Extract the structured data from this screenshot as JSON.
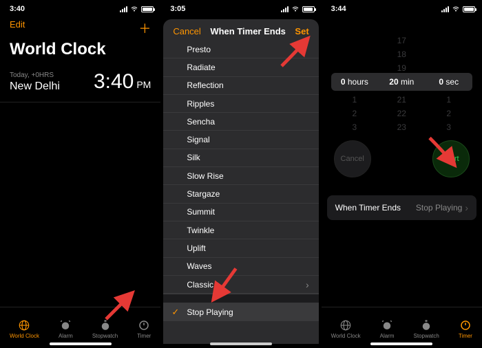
{
  "accent": "#ff9500",
  "phone1": {
    "status_time": "3:40",
    "edit": "Edit",
    "title": "World Clock",
    "clock": {
      "meta": "Today, +0HRS",
      "city": "New Delhi",
      "time": "3:40",
      "ampm": "PM"
    },
    "tabs": {
      "worldclock": "World Clock",
      "alarm": "Alarm",
      "stopwatch": "Stopwatch",
      "timer": "Timer",
      "active": "worldclock"
    }
  },
  "phone2": {
    "status_time": "3:05",
    "header": {
      "cancel": "Cancel",
      "title": "When Timer Ends",
      "set": "Set"
    },
    "sounds": [
      "Presto",
      "Radiate",
      "Reflection",
      "Ripples",
      "Sencha",
      "Signal",
      "Silk",
      "Slow Rise",
      "Stargaze",
      "Summit",
      "Twinkle",
      "Uplift",
      "Waves",
      "Classic"
    ],
    "stop_playing": "Stop Playing"
  },
  "phone3": {
    "status_time": "3:44",
    "picker": {
      "hours_value": "0",
      "hours_unit": "hours",
      "min_value": "20",
      "min_unit": "min",
      "sec_value": "0",
      "sec_unit": "sec",
      "fade_top_h": [
        "17",
        "18",
        "19"
      ],
      "fade_bot_h": [
        "21",
        "22",
        "23"
      ],
      "fade_top_m": [
        "",
        "",
        ""
      ],
      "fade_bot_m": [
        "1",
        "2",
        "3"
      ],
      "fade_top_s": [
        "",
        "",
        ""
      ],
      "fade_bot_s": [
        "1",
        "2",
        "3"
      ]
    },
    "cancel": "Cancel",
    "start": "Start",
    "ends": {
      "label": "When Timer Ends",
      "value": "Stop Playing"
    },
    "tabs": {
      "worldclock": "World Clock",
      "alarm": "Alarm",
      "stopwatch": "Stopwatch",
      "timer": "Timer",
      "active": "timer"
    }
  }
}
